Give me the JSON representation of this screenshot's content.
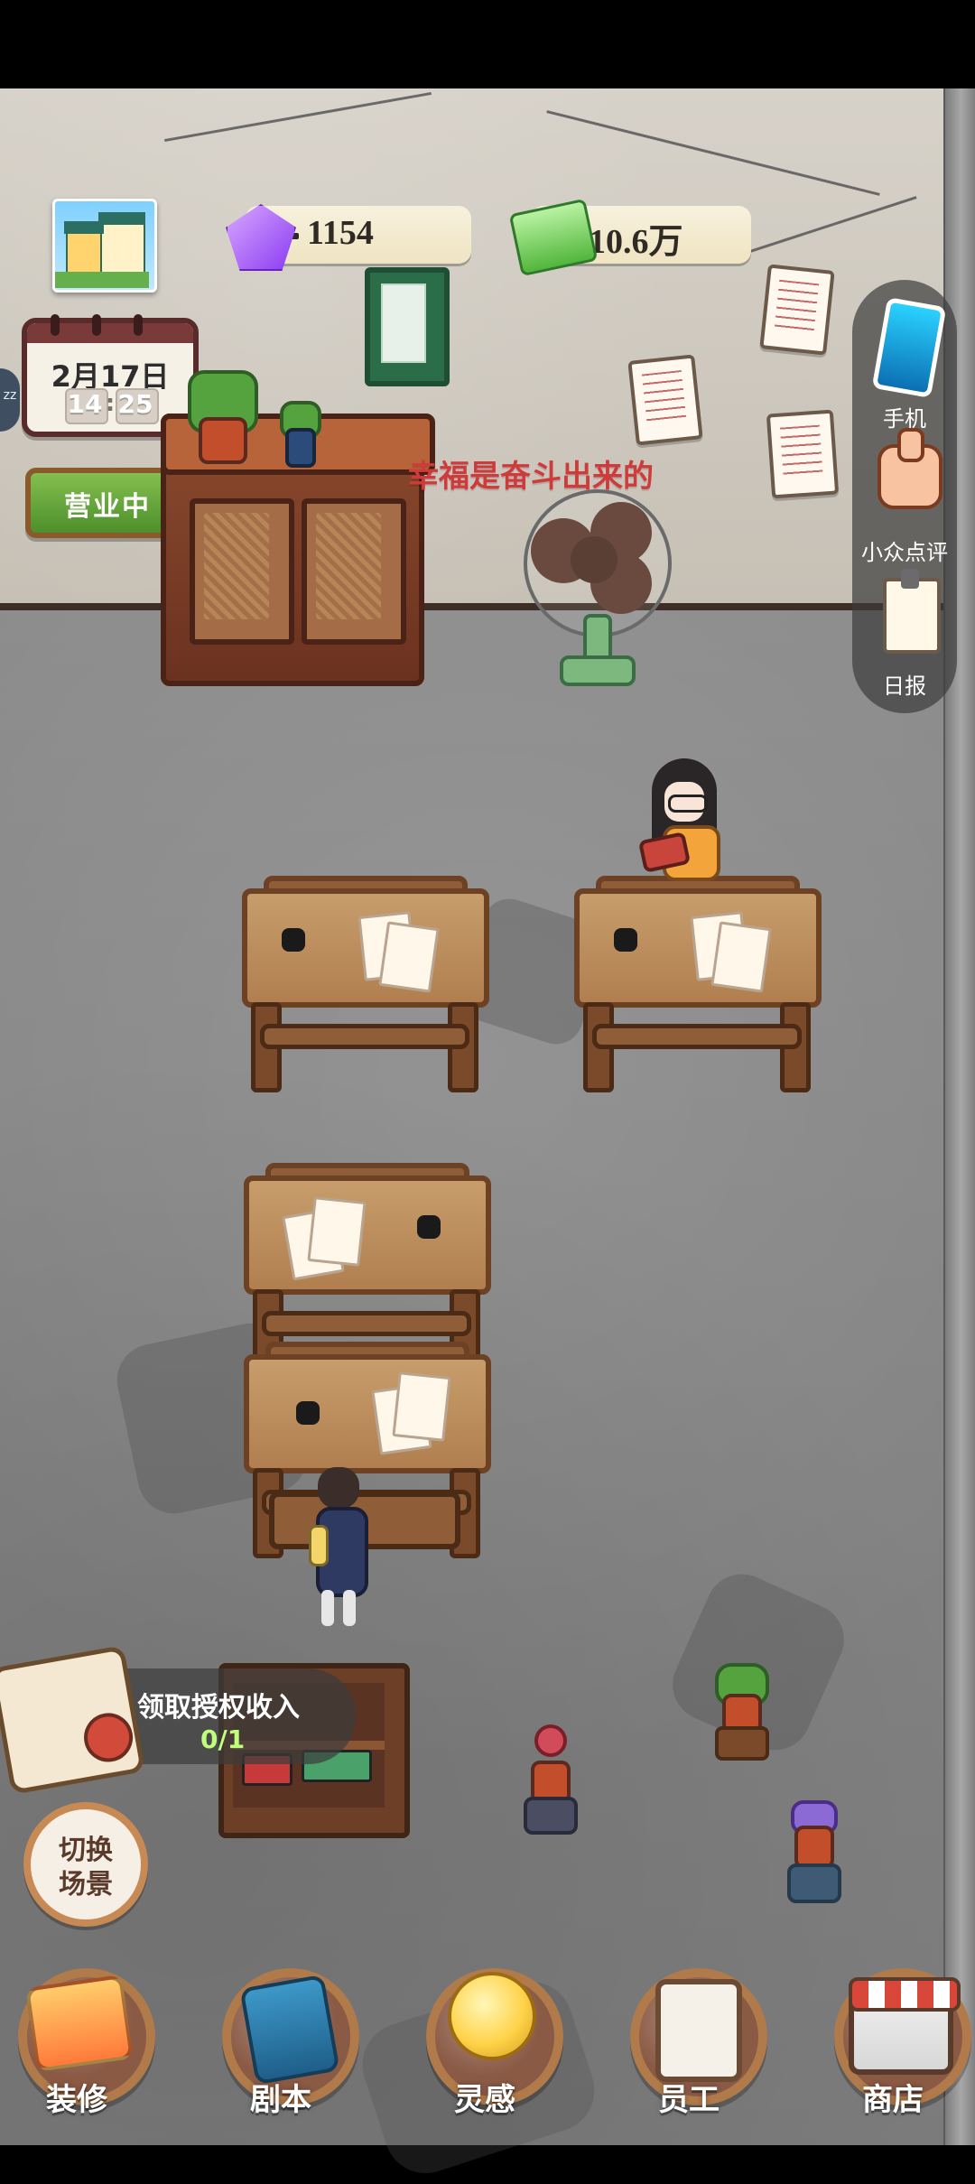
{
  "status_bar": {},
  "hud": {
    "gems": "1154",
    "money": "10.6万",
    "date": "2月17日",
    "time_hour": "14",
    "time_minute": "25",
    "business_status": "营业中",
    "slogan": "幸福是奋斗出来的",
    "side_hint": "zz"
  },
  "side_menu": [
    {
      "label": "手机",
      "icon": "phone-icon"
    },
    {
      "label": "小众点评",
      "icon": "thumbs-up-icon"
    },
    {
      "label": "日报",
      "icon": "clipboard-icon"
    }
  ],
  "quest": {
    "title": "领取授权收入",
    "progress": "0/1"
  },
  "switch_scene": {
    "line1": "切换",
    "line2": "场景"
  },
  "bottom_nav": [
    {
      "label": "装修",
      "icon": "house-icon"
    },
    {
      "label": "剧本",
      "icon": "book-icon"
    },
    {
      "label": "灵感",
      "icon": "lightbulb-icon"
    },
    {
      "label": "员工",
      "icon": "badge-icon"
    },
    {
      "label": "商店",
      "icon": "shop-icon"
    }
  ],
  "colors": {
    "accent_green": "#5aa03a",
    "wood_brown": "#6c4124",
    "ui_gold": "#b07a4a",
    "quest_progress_green": "#bfff7b"
  }
}
